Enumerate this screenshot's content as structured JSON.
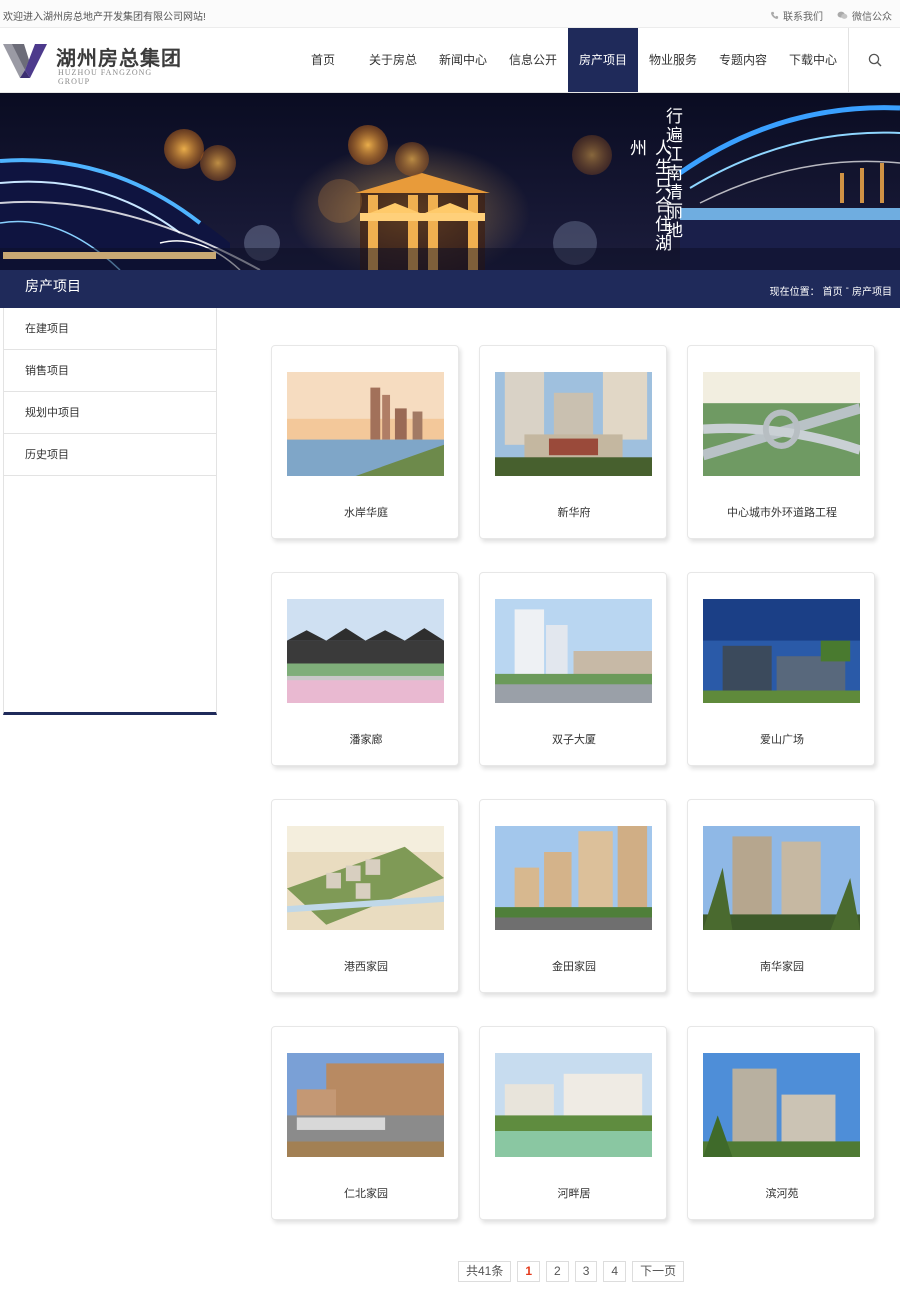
{
  "topbar": {
    "welcome": "欢迎进入湖州房总地产开发集团有限公司网站!",
    "contact": "联系我们",
    "wechat": "微信公众"
  },
  "logo": {
    "cn": "湖州房总集团",
    "en": "HUZHOU FANGZONG GROUP"
  },
  "nav": {
    "items": [
      "首页",
      "关于房总",
      "新闻中心",
      "信息公开",
      "房产项目",
      "物业服务",
      "专题内容",
      "下载中心"
    ],
    "active_index": 4
  },
  "banner": {
    "line1": "行遍江南清丽地",
    "line2": "人生只合住湖州"
  },
  "section": {
    "title": "房产项目",
    "breadcrumb_label": "现在位置：",
    "breadcrumb_home": "首页",
    "breadcrumb_sep": "-",
    "breadcrumb_current": "房产项目"
  },
  "sidebar": {
    "items": [
      "在建项目",
      "销售项目",
      "规划中项目",
      "历史项目"
    ]
  },
  "projects": [
    {
      "name": "水岸华庭"
    },
    {
      "name": "新华府"
    },
    {
      "name": "中心城市外环道路工程"
    },
    {
      "name": "潘家廊"
    },
    {
      "name": "双子大厦"
    },
    {
      "name": "爱山广场"
    },
    {
      "name": "港西家园"
    },
    {
      "name": "金田家园"
    },
    {
      "name": "南华家园"
    },
    {
      "name": "仁北家园"
    },
    {
      "name": "河畔居"
    },
    {
      "name": "滨河苑"
    }
  ],
  "pagination": {
    "total": "共41条",
    "pages": [
      "1",
      "2",
      "3",
      "4"
    ],
    "current": "1",
    "next": "下一页"
  },
  "colors": {
    "navy": "#1f2a5a",
    "gold": "#c8a874",
    "current_page": "#e4391b"
  }
}
